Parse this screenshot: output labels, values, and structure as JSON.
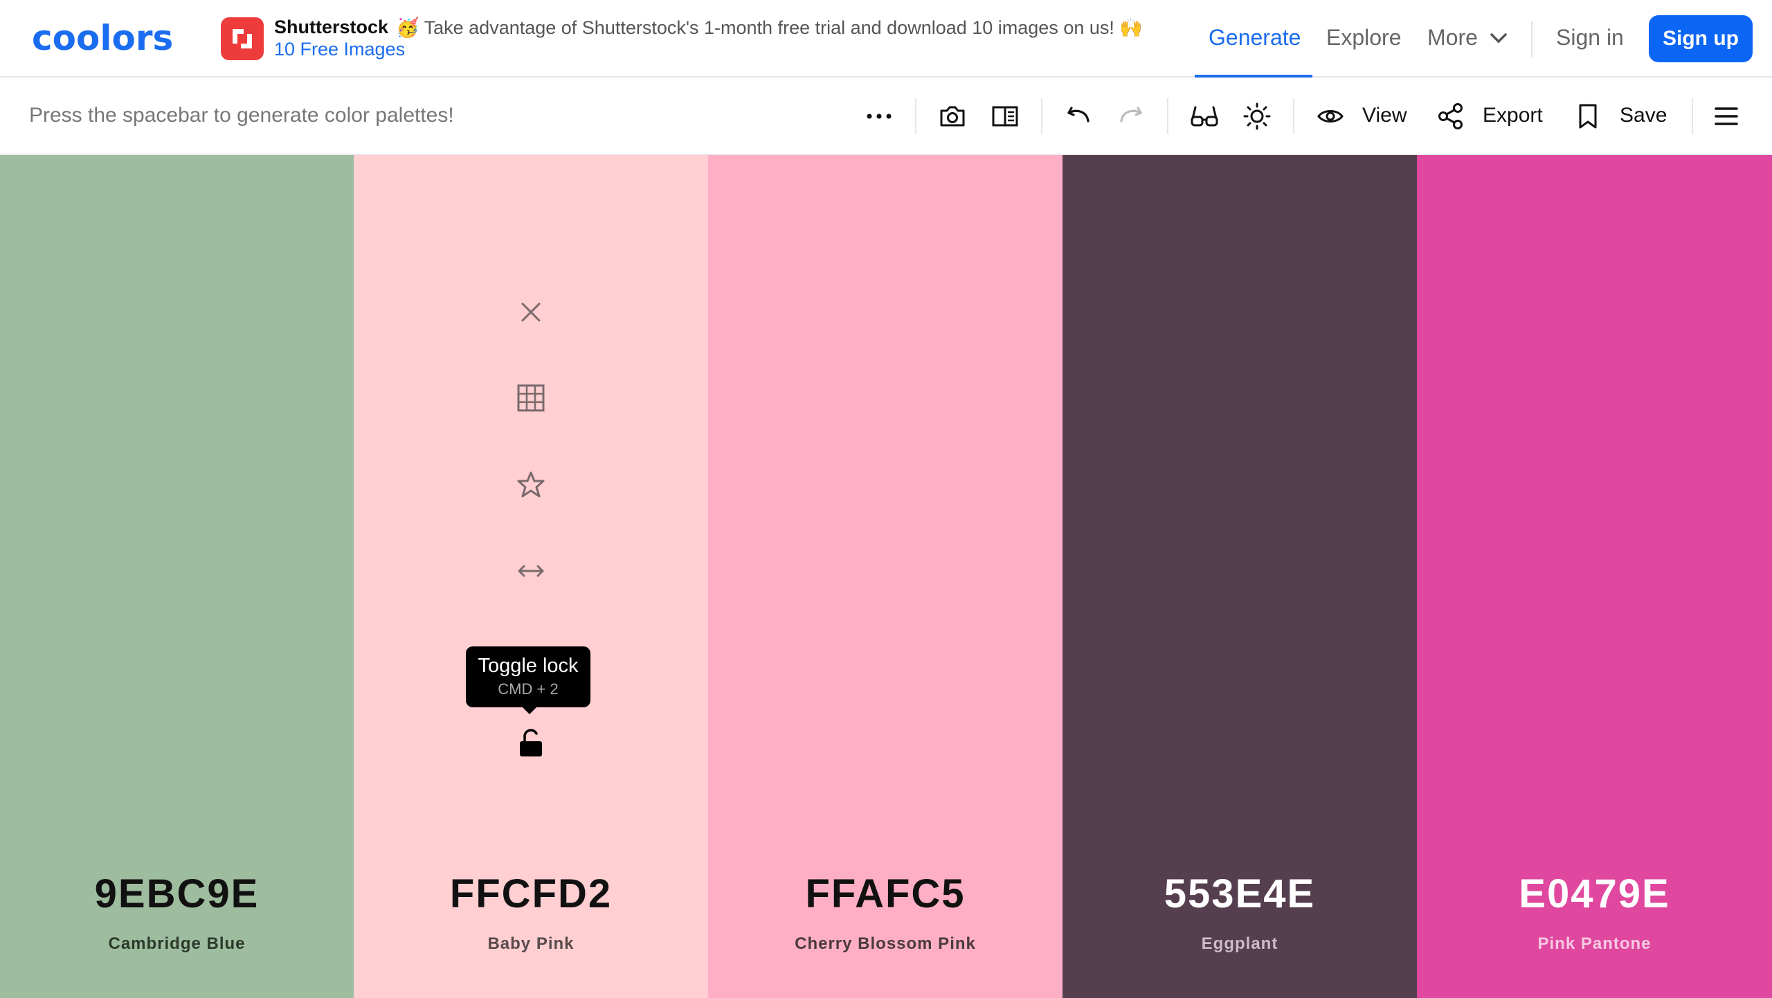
{
  "nav": {
    "logo_text": "coolors",
    "ad": {
      "title": "Shutterstock",
      "text": "🥳 Take advantage of Shutterstock's 1-month free trial and download 10 images on us! 🙌",
      "link": "10 Free Images"
    },
    "links": {
      "generate": "Generate",
      "explore": "Explore",
      "more": "More",
      "signin": "Sign in"
    },
    "signup": "Sign up",
    "brand_color": "#1a6cf0"
  },
  "toolbar": {
    "hint": "Press the spacebar to generate color palettes!",
    "view": "View",
    "export": "Export",
    "save": "Save"
  },
  "palette": [
    {
      "hex": "9EBC9E",
      "name": "Cambridge Blue",
      "color": "#9EBC9E"
    },
    {
      "hex": "FFCFD2",
      "name": "Baby Pink",
      "color": "#FFCFD2"
    },
    {
      "hex": "FFAFC5",
      "name": "Cherry Blossom Pink",
      "color": "#FFAFC5"
    },
    {
      "hex": "553E4E",
      "name": "Eggplant",
      "color": "#553E4E"
    },
    {
      "hex": "E0479E",
      "name": "Pink Pantone",
      "color": "#E0479E"
    }
  ],
  "tooltip": {
    "title": "Toggle lock",
    "shortcut": "CMD + 2"
  }
}
